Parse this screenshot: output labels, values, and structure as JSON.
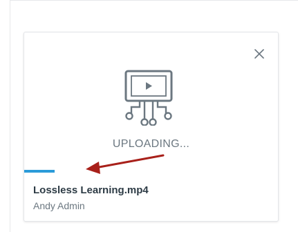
{
  "upload_card": {
    "status_text": "UPLOADING...",
    "progress": 0.12,
    "file_name": "Lossless Learning.mp4",
    "author": "Andy Admin",
    "media_icon": "video-media-icon",
    "close_icon": "close-icon"
  },
  "annotation": {
    "arrow_icon": "arrow-annotation"
  },
  "colors": {
    "accent": "#2b9bd9",
    "arrow": "#a8201a",
    "icon": "#6b7780"
  }
}
